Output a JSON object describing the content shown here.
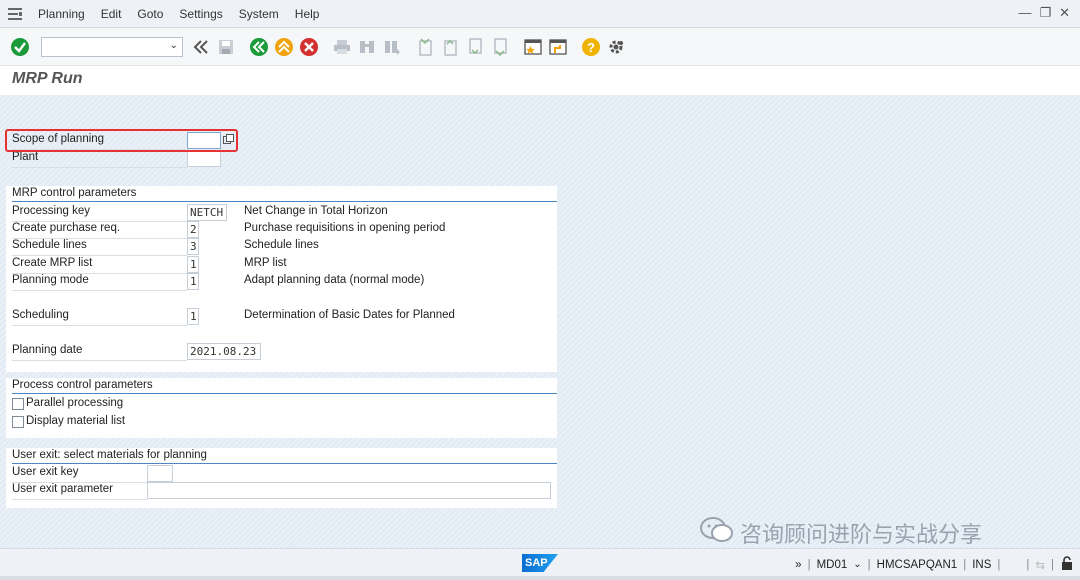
{
  "menubar": {
    "items": [
      "Planning",
      "Edit",
      "Goto",
      "Settings",
      "System",
      "Help"
    ]
  },
  "toolbar": {
    "command_value": ""
  },
  "title": "MRP Run",
  "header_fields": {
    "scope_label": "Scope of planning",
    "scope_value": "",
    "plant_label": "Plant",
    "plant_value": ""
  },
  "mrp_control": {
    "title": "MRP control parameters",
    "rows": [
      {
        "label": "Processing key",
        "value": "NETCH",
        "desc": "Net Change in Total Horizon"
      },
      {
        "label": "Create purchase req.",
        "value": "2",
        "desc": "Purchase requisitions in opening period"
      },
      {
        "label": "Schedule lines",
        "value": "3",
        "desc": "Schedule lines"
      },
      {
        "label": "Create MRP list",
        "value": "1",
        "desc": "MRP list"
      },
      {
        "label": "Planning mode",
        "value": "1",
        "desc": "Adapt planning data (normal mode)"
      },
      {
        "label": "Scheduling",
        "value": "1",
        "desc": "Determination of Basic Dates for Planned"
      },
      {
        "label": "Planning date",
        "value": "2021.08.23",
        "desc": ""
      }
    ]
  },
  "process_control": {
    "title": "Process control parameters",
    "parallel_label": "Parallel processing",
    "display_list_label": "Display material list"
  },
  "user_exit": {
    "title": "User exit: select materials for planning",
    "key_label": "User exit key",
    "key_value": "",
    "param_label": "User exit parameter",
    "param_value": ""
  },
  "statusbar": {
    "logo": "SAP",
    "transaction": "MD01",
    "server": "HMCSAPQAN1",
    "mode": "INS"
  },
  "watermark": "咨询顾问进阶与实战分享",
  "colors": {
    "accent_blue": "#4a86c5",
    "highlight_red": "#e53333",
    "check_green": "#1b9a3a",
    "nav_green": "#1b9a3a",
    "nav_orange": "#f0a30a",
    "cancel_red": "#d43030",
    "help_yellow": "#f0b400"
  },
  "icons": [
    "menu-icon",
    "check-icon",
    "back-icon",
    "save-icon",
    "back-green-icon",
    "exit-icon",
    "cancel-icon",
    "print-icon",
    "find-icon",
    "find-next-icon",
    "first-page-icon",
    "prev-page-icon",
    "next-page-icon",
    "last-page-icon",
    "new-session-icon",
    "shortcut-icon",
    "help-icon",
    "settings-icon",
    "match-code-icon",
    "lock-icon"
  ]
}
